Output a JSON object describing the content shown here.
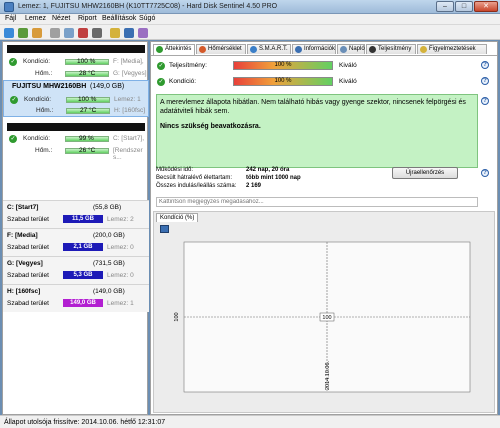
{
  "window": {
    "title": "Lemez: 1, FUJITSU MHW2160BH (K10TT7725C08) - Hard Disk Sentinel 4.50 PRO",
    "min": "–",
    "max": "□",
    "close": "✕"
  },
  "menu": [
    "Fájl",
    "Lemez",
    "Nézet",
    "Riport",
    "Beállítások",
    "Súgó"
  ],
  "drives": [
    {
      "name": "",
      "condition_label": "Kondíció:",
      "condition": "100 %",
      "temp_label": "Hőm.:",
      "temp": "28 °C",
      "side1": "F: [Media],",
      "side2": "G: [Vegyes]"
    },
    {
      "name": "FUJITSU MHW2160BH",
      "size": "(149,0 GB)",
      "condition_label": "Kondíció:",
      "condition": "100 %",
      "temp_label": "Hőm.:",
      "temp": "27 °C",
      "side1": "Lemez: 1",
      "side2": "H: [160fsc]"
    },
    {
      "name": "",
      "condition_label": "Kondíció:",
      "condition": "99 %",
      "temp_label": "Hőm.:",
      "temp": "26 °C",
      "side1": "C: [Start7],",
      "side2": "[Rendszer s..."
    }
  ],
  "volumes": [
    {
      "name": "C: [Start7]",
      "size": "(55,8 GB)",
      "free_label": "Szabad terület",
      "free": "11,5 GB",
      "disk": "Lemez: 2",
      "color": "#1d1ab7"
    },
    {
      "name": "F: [Media]",
      "size": "(200,0 GB)",
      "free_label": "Szabad terület",
      "free": "2,1 GB",
      "disk": "Lemez: 0",
      "color": "#1d1ab7"
    },
    {
      "name": "G: [Vegyes]",
      "size": "(731,5 GB)",
      "free_label": "Szabad terület",
      "free": "5,3 GB",
      "disk": "Lemez: 0",
      "color": "#1d1ab7"
    },
    {
      "name": "H: [160fsc]",
      "size": "(149,0 GB)",
      "free_label": "Szabad terület",
      "free": "149,0 GB",
      "disk": "Lemez: 1",
      "color": "#b21fd1"
    }
  ],
  "tabs": [
    "Áttekintés",
    "Hőmérséklet",
    "S.M.A.R.T.",
    "Információk",
    "Napló",
    "Teljesítmény",
    "Figyelmeztetések"
  ],
  "metrics": [
    {
      "label": "Teljesítmény:",
      "value": "100 %",
      "rating": "Kiváló",
      "level": 1.0
    },
    {
      "label": "Kondíció:",
      "value": "100 %",
      "rating": "Kiváló",
      "level": 1.0
    }
  ],
  "status": {
    "text": "A merevlemez állapota hibátlan. Nem található hibás vagy gyenge szektor, nincsenek felpörgési és adatátviteli hibák sem.",
    "action": "Nincs szükség beavatkozásra."
  },
  "info": {
    "uptime_label": "Működési idő:",
    "uptime": "242 nap, 20 óra",
    "remaining_label": "Becsült hátralévő élettartam:",
    "remaining": "több mint 1000 nap",
    "starts_label": "Összes indulás/leállás száma:",
    "starts": "2 169",
    "refresh_button": "Újraellenőrzés",
    "comment_placeholder": "Kattintson megjegyzés megadásához..."
  },
  "chart_data": {
    "type": "line",
    "tab": "Kondíció (%)",
    "x": [
      "2014.10.06."
    ],
    "series": [
      {
        "values": [
          100
        ]
      }
    ],
    "ylabel": "",
    "ytick": "100",
    "xtick": "2014.10.06.",
    "data_label": "100"
  },
  "statusbar": {
    "text": "Állapot utolsója frissítve: 2014.10.06. hétfő 12:31:07"
  }
}
